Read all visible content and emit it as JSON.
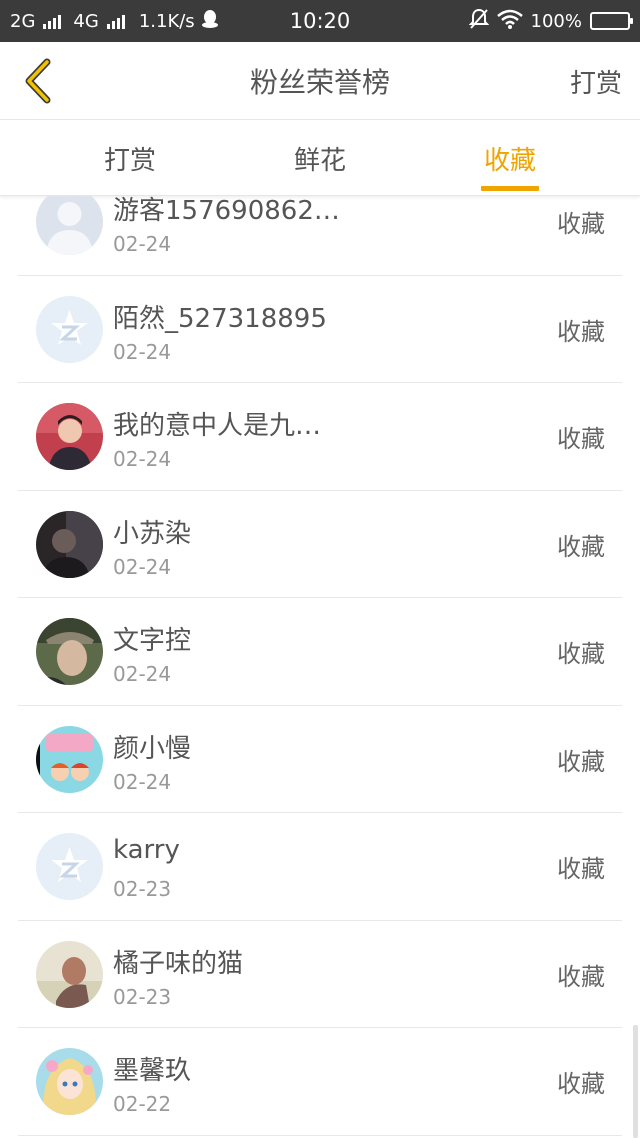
{
  "status_bar": {
    "network_2g": "2G",
    "network_4g": "4G",
    "speed": "1.1K/s",
    "time": "10:20",
    "battery": "100%",
    "icons": [
      "signal-icon",
      "qq-icon",
      "mute-icon",
      "wifi-icon",
      "battery-icon"
    ]
  },
  "nav": {
    "back_icon": "chevron-left-icon",
    "title": "粉丝荣誉榜",
    "right_label": "打赏"
  },
  "tabs": [
    {
      "label": "打赏",
      "active": false
    },
    {
      "label": "鲜花",
      "active": false
    },
    {
      "label": "收藏",
      "active": true
    }
  ],
  "colors": {
    "accent": "#f0a400",
    "text": "#555555",
    "subtext": "#999999",
    "statusbar": "#3b3b3b"
  },
  "rows": [
    {
      "name": "游客157690862…",
      "date": "02-24",
      "action": "收藏",
      "avatar": "default-user-avatar"
    },
    {
      "name": "陌然_527318895",
      "date": "02-24",
      "action": "收藏",
      "avatar": "qq-default-avatar"
    },
    {
      "name": "我的意中人是九…",
      "date": "02-24",
      "action": "收藏",
      "avatar": "photo-avatar"
    },
    {
      "name": "小苏染",
      "date": "02-24",
      "action": "收藏",
      "avatar": "photo-avatar"
    },
    {
      "name": "文字控",
      "date": "02-24",
      "action": "收藏",
      "avatar": "photo-avatar"
    },
    {
      "name": "颜小慢",
      "date": "02-24",
      "action": "收藏",
      "avatar": "cartoon-avatar"
    },
    {
      "name": "karry",
      "date": "02-23",
      "action": "收藏",
      "avatar": "qq-default-avatar"
    },
    {
      "name": "橘子味的猫",
      "date": "02-23",
      "action": "收藏",
      "avatar": "photo-avatar"
    },
    {
      "name": "墨馨玖",
      "date": "02-22",
      "action": "收藏",
      "avatar": "anime-avatar"
    }
  ]
}
